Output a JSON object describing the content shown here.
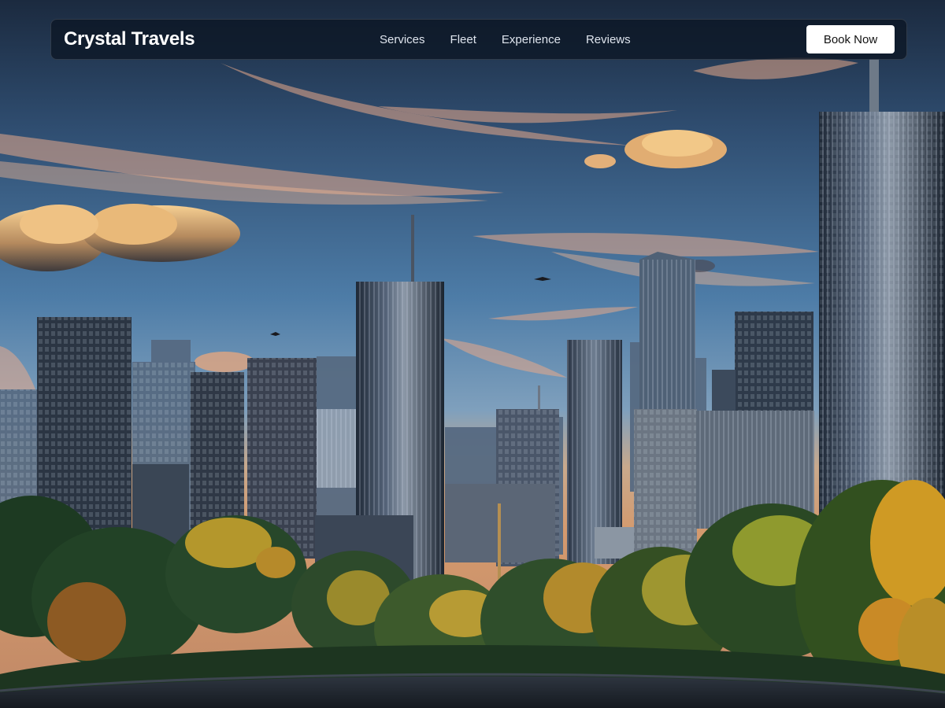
{
  "navbar": {
    "brand": "Crystal Travels",
    "links": [
      {
        "label": "Services"
      },
      {
        "label": "Fleet"
      },
      {
        "label": "Experience"
      },
      {
        "label": "Reviews"
      }
    ],
    "cta_label": "Book Now"
  },
  "hero": {
    "scene": "city skyline at sunset with trees in the foreground",
    "colors": {
      "sky_top": "#1e3048",
      "sky_mid": "#3f6f9c",
      "sky_horizon": "#d9a27a",
      "cloud_light": "#f4c98e",
      "cloud_dark": "#5a4a44",
      "building": "#2a3443",
      "foliage_green": "#1f3a24",
      "foliage_yellow": "#c9a024"
    }
  }
}
